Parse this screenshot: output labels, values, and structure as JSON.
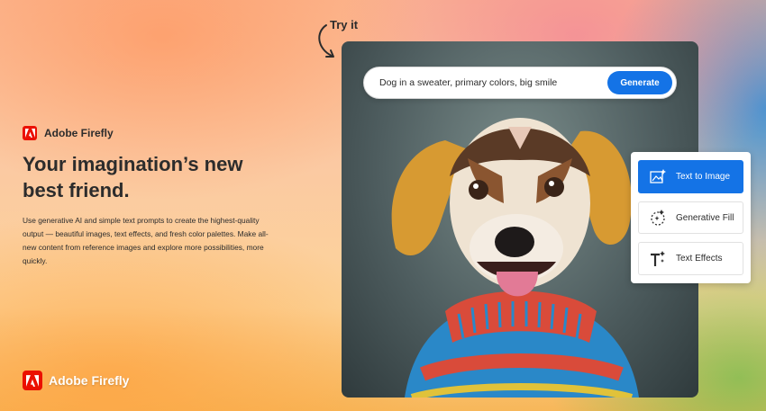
{
  "brand": {
    "name": "Adobe Firefly"
  },
  "hero": {
    "headline": "Your imagination’s new best friend.",
    "description": "Use generative AI and simple text prompts to create the highest-quality output — beautiful images, text effects, and fresh color palettes. Make all-new content from reference images and explore more possibilities, more quickly."
  },
  "try_it": {
    "label": "Try it"
  },
  "prompt": {
    "text": "Dog in a sweater, primary colors, big smile",
    "generate_label": "Generate"
  },
  "tools": [
    {
      "label": "Text to Image",
      "icon": "text-to-image-icon",
      "active": true
    },
    {
      "label": "Generative Fill",
      "icon": "generative-fill-icon",
      "active": false
    },
    {
      "label": "Text Effects",
      "icon": "text-effects-icon",
      "active": false
    }
  ],
  "footer": {
    "brand_name": "Adobe Firefly"
  },
  "colors": {
    "accent": "#1473e6",
    "adobe_red": "#eb1000"
  }
}
